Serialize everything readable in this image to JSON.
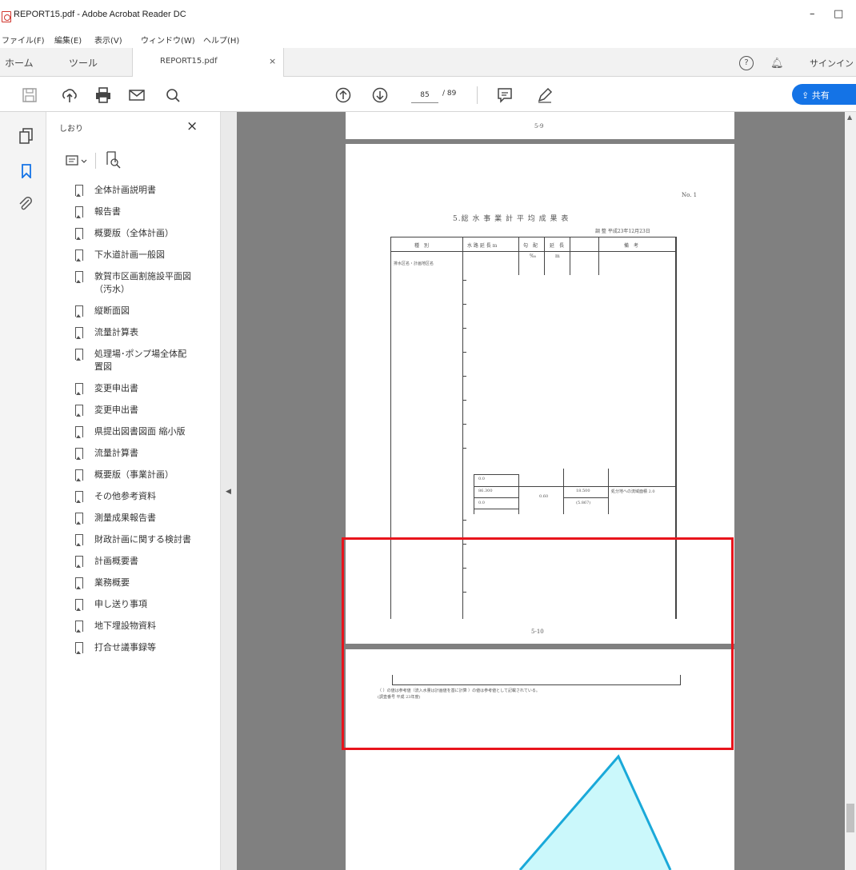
{
  "window": {
    "title": "REPORT15.pdf - Adobe Acrobat Reader DC",
    "minimize": "–",
    "maximize": "□",
    "close": "×"
  },
  "menu": [
    "ファイル(F)",
    "編集(E)",
    "表示(V)",
    "ウィンドウ(W)",
    "ヘルプ(H)"
  ],
  "tabs": {
    "home": "ホーム",
    "tools": "ツール",
    "document": "REPORT15.pdf",
    "close": "×"
  },
  "header_right": {
    "help": "?",
    "signin": "サインイン"
  },
  "toolbar": {
    "current_page": "85",
    "total_pages": "/ 89",
    "share": "共有"
  },
  "bookmarks_panel": {
    "title": "しおり",
    "close": "×",
    "items": [
      "全体計画説明書",
      "報告書",
      "概要版（全体計画）",
      "下水道計画一般図",
      "敦賀市区画割施設平面図（汚水）",
      "縦断面図",
      "流量計算表",
      "処理場･ポンプ場全体配置図",
      "変更申出書",
      "変更申出書",
      "県提出図書図面 縮小版",
      "流量計算書",
      "概要版（事業計画）",
      "その他参考資料",
      "測量成果報告書",
      "財政計画に関する検討書",
      "計画概要書",
      "業務概要",
      "申し送り事項",
      "地下埋設物資料",
      "打合せ議事録等"
    ]
  },
  "document": {
    "page_top_footer": "5-9",
    "page_no": "No.  1",
    "table_title": "5.総 水 事 業 計 平 均 成 果 表",
    "table_subtitle": "調 整 平成23年12月23日",
    "table_headers": [
      "種　別",
      "水 路 延 長 m",
      "勾　配",
      "延　長",
      "備　考"
    ],
    "header_units": [
      "‰",
      "m"
    ],
    "row_label": "排水区名・計画地区名",
    "cell_values": [
      "0.0",
      "86.300",
      "0.60",
      "0.0",
      "18.500",
      "(5.867)",
      "処分地への流域面積 2.0"
    ],
    "page_footer": "5-10",
    "note_line1": "（ ）の値は参考値（流入水量は計画値を基に計算 ）の値は参考値として記載されている。",
    "note_line2": "(調査番号 平成 23年度)",
    "colors": {
      "highlight": "#e8141c",
      "callout_fill": "#cbf8fb",
      "callout_stroke": "#1aa9d9",
      "share_button": "#1473e6"
    }
  }
}
